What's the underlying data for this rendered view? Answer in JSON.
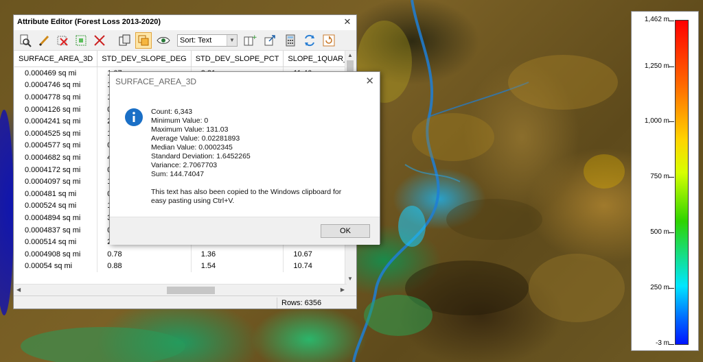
{
  "legend": {
    "labels": [
      "1,462 m",
      "1,250 m",
      "1,000 m",
      "750 m",
      "500 m",
      "250 m",
      "-3 m"
    ],
    "colors": [
      "#ff0000",
      "#ffd500",
      "#2ed400",
      "#00e6ff",
      "#0014ff"
    ]
  },
  "attribute_editor": {
    "title": "Attribute Editor (Forest Loss 2013-2020)",
    "close_icon": "close-icon",
    "toolbar": {
      "icons": [
        "zoom-to-feature-icon",
        "edit-pencil-icon",
        "delete-selected-icon",
        "select-features-icon",
        "clear-selection-icon",
        "copy-icon",
        "highlight-selected-icon",
        "view-eye-icon",
        "add-column-icon",
        "export-icon",
        "calculator-icon",
        "swap-icon",
        "refresh-icon"
      ],
      "sort_label": "Sort: Text"
    },
    "columns": [
      "SURFACE_AREA_3D",
      "STD_DEV_SLOPE_DEG",
      "STD_DEV_SLOPE_PCT",
      "SLOPE_1QUAR_DEG"
    ],
    "rows": [
      [
        "0.000469 sq mi",
        "1.07",
        "3.21",
        "11.46"
      ],
      [
        "0.0004746 sq mi",
        "1.",
        "",
        ""
      ],
      [
        "0.0004778 sq mi",
        "1.",
        "",
        ""
      ],
      [
        "0.0004126 sq mi",
        "0.",
        "",
        ""
      ],
      [
        "0.0004241 sq mi",
        "2.",
        "",
        ""
      ],
      [
        "0.0004525 sq mi",
        "1.",
        "",
        ""
      ],
      [
        "0.0004577 sq mi",
        "0.",
        "",
        ""
      ],
      [
        "0.0004682 sq mi",
        "4.",
        "",
        ""
      ],
      [
        "0.0004172 sq mi",
        "0.",
        "",
        ""
      ],
      [
        "0.0004097 sq mi",
        "1.",
        "",
        ""
      ],
      [
        "0.000481 sq mi",
        "0.",
        "",
        ""
      ],
      [
        "0.000524 sq mi",
        "1.",
        "",
        ""
      ],
      [
        "0.0004894 sq mi",
        "3.",
        "",
        ""
      ],
      [
        "0.0004837 sq mi",
        "0.",
        "",
        ""
      ],
      [
        "0.000514 sq mi",
        "2.24",
        "3.90",
        "18.85"
      ],
      [
        "0.0004908 sq mi",
        "0.78",
        "1.36",
        "10.67"
      ],
      [
        "0.00054 sq mi",
        "0.88",
        "1.54",
        "10.74"
      ]
    ],
    "status": "Rows: 6356"
  },
  "dialog": {
    "title": "SURFACE_AREA_3D",
    "icon": "info-icon",
    "stats": [
      "Count: 6,343",
      "Minimum Value: 0",
      "Maximum Value: 131.03",
      "Average Value: 0.02281893",
      "Median Value: 0.0002345",
      "Standard Deviation: 1.6452265",
      "Variance: 2.7067703",
      "Sum: 144.74047"
    ],
    "note_line1": "This text has also been copied to the Windows clipboard for",
    "note_line2": "easy pasting using Ctrl+V.",
    "ok_label": "OK"
  }
}
